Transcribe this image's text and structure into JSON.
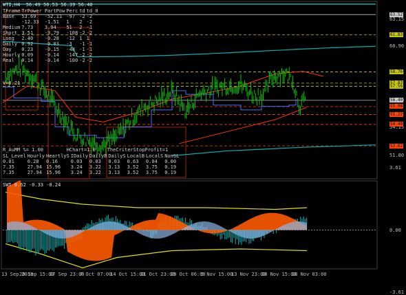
{
  "main": {
    "title": "WTI,H4  56.49 56.53 56.39 56.40",
    "ylim": [
      50.0,
      64.5
    ],
    "yticks": [
      63.15,
      60.9,
      58.65,
      56.4,
      54.15,
      51.8
    ],
    "price_labels": [
      {
        "value": 63.52,
        "label": "63.52",
        "color": "#c8c8c8"
      },
      {
        "value": 61.83,
        "label": "61.83",
        "color": "#c8c800"
      },
      {
        "value": 58.76,
        "label": "58.76",
        "color": "#c8c800"
      },
      {
        "value": 57.83,
        "label": "57.83",
        "color": "#c8c800"
      },
      {
        "value": 57.56,
        "label": "57.56",
        "color": "#c8c800"
      },
      {
        "value": 56.4,
        "label": "56.40",
        "color": "#c8c8c8"
      },
      {
        "value": 55.88,
        "label": "55.88",
        "color": "#ff4500"
      },
      {
        "value": 55.22,
        "label": "55.22",
        "color": "#ff4500"
      },
      {
        "value": 54.4,
        "label": "54.40",
        "color": "#ff4500"
      },
      {
        "value": 52.62,
        "label": "52.62",
        "color": "#ff4500"
      }
    ],
    "v_text": "V=0.21",
    "top_table": {
      "headers": [
        "TFrame",
        "TrPower",
        "",
        "PartPow",
        "Perc",
        "td",
        "td_0"
      ],
      "rows": [
        [
          "Base",
          "53.69",
          "",
          "-52.11",
          "-97",
          "-2",
          "-2"
        ],
        [
          "",
          "-12.33",
          "",
          "-1.51",
          "1",
          "2",
          "-2"
        ],
        [
          "Medium",
          "7.73",
          "",
          "3.94",
          "51",
          "2",
          "-1"
        ],
        [
          "Short",
          "3.51",
          "",
          "-3.79",
          "-108",
          "-2",
          "-2"
        ],
        [
          "Long",
          "2.40",
          "",
          "-0.28",
          "-12",
          "1",
          "1"
        ],
        [
          "Daily",
          "0.92",
          "",
          "-0.03",
          "-3",
          "-1",
          "-1"
        ],
        [
          "Day",
          "0.23",
          "",
          "-0.15",
          "-48",
          "-1",
          "-1"
        ],
        [
          "Hourly",
          "0.09",
          "",
          "-0.14",
          "-147",
          "-2",
          "-2"
        ],
        [
          "Real",
          "0.14",
          "",
          "-0.14",
          "-100",
          "-2",
          "-2"
        ]
      ]
    },
    "stop_header": "R_AuMM %= 1.00        HChart=1.0    TheCriterStopProfit=1",
    "stop_table": {
      "headers": [
        "SL_Level",
        "Hourly",
        "HeartlyS",
        "IDaily",
        "DailyB",
        "DailyS",
        "LocalB",
        "LocalS",
        "NonSL"
      ],
      "rows": [
        [
          "0.01",
          "0.28",
          "0.16",
          "0.03",
          "0.03",
          "0.03",
          "0.63",
          "0.04",
          "0.00"
        ],
        [
          "7.35",
          "27.94",
          "15.96",
          "3.24",
          "3.22",
          "3.13",
          "3.52",
          "3.75",
          "0.19"
        ],
        [
          "7.35",
          "27.94",
          "15.96",
          "3.24",
          "3.22",
          "3.13",
          "3.52",
          "3.75",
          "0.19"
        ]
      ]
    }
  },
  "sub": {
    "title": "SWT 0.62 -0.33 -0.24",
    "yticks": [
      "3.61",
      "0.00",
      "-3.61"
    ]
  },
  "xaxis": {
    "labels": [
      "13 Sep 2019",
      "20 Sep 15:00",
      "27 Sep 23:00",
      "7 Oct 07:00",
      "14 Oct 15:00",
      "21 Oct 23:00",
      "29 Oct 06:00",
      "5 Nov 15:00",
      "13 Nov 23:00",
      "20 Nov 15:00",
      "28 Nov 03:00"
    ]
  },
  "colors": {
    "candles": "#00c800",
    "cyan": "#00b4b4",
    "redline": "#ff3300",
    "blueline": "#4a6cff",
    "yellow": "#e0e000",
    "orange": "#ff5a00",
    "hist": "#00a0a0",
    "lightblue": "#8cb4e6"
  }
}
